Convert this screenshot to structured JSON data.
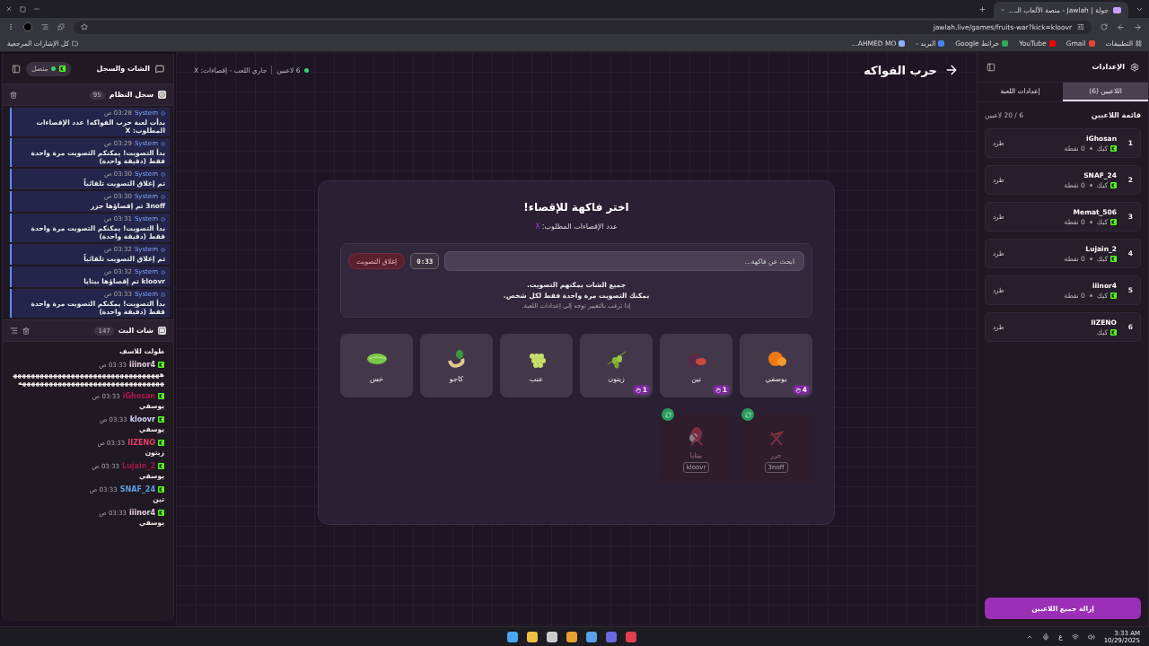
{
  "browser": {
    "tab_title": "جولة | Jawlah - منصة الألعاب الـ...",
    "url": "jawlah.live/games/fruits-war?kick=kloovr",
    "bookmarks": [
      {
        "label": "التطبيقات"
      },
      {
        "label": "Gmail"
      },
      {
        "label": "YouTube"
      },
      {
        "label": "خرائط Google"
      },
      {
        "label": "البريد -"
      },
      {
        "label": "AHMED MO..."
      }
    ],
    "all_bookmarks": "كل الإشارات المرجعية"
  },
  "settings_panel": {
    "title": "الإعدادات",
    "tabs": [
      {
        "label": "اللاعبين (6)",
        "selected": true
      },
      {
        "label": "إعدادات اللعبة",
        "selected": false
      }
    ],
    "list_title": "قائمة اللاعبين",
    "count": "6 / 20 لاعبين",
    "players": [
      {
        "rank": "1",
        "name": "iGhosan",
        "platform": "كيك",
        "points": "0 نقطة",
        "kick": "طرد"
      },
      {
        "rank": "2",
        "name": "SNAF_24",
        "platform": "كيك",
        "points": "0 نقطة",
        "kick": "طرد"
      },
      {
        "rank": "3",
        "name": "Memat_506",
        "platform": "كيك",
        "points": "0 نقطة",
        "kick": "طرد"
      },
      {
        "rank": "4",
        "name": "Lujain_2",
        "platform": "كيك",
        "points": "0 نقطة",
        "kick": "طرد"
      },
      {
        "rank": "5",
        "name": "iiinor4",
        "platform": "كيك",
        "points": "0 نقطة",
        "kick": "طرد"
      },
      {
        "rank": "6",
        "name": "IIZENO",
        "platform": "كيك",
        "kick": "طرد"
      }
    ],
    "remove_all": "إزالة جميع اللاعبين"
  },
  "game": {
    "title": "حرب الفواكه",
    "status": "جاري اللعب - إقصاءات: X",
    "players_online": "6 لاعبين",
    "heading": "اختر فاكهة للإقصاء!",
    "eliminations_label": "عدد الإقصاءات المطلوب:",
    "eliminations_value": "X",
    "search_placeholder": "ابحث عن فاكهة...",
    "timer": "0:33",
    "close_vote": "إغلاق التصويت",
    "notes": [
      {
        "text": "جميع الشات يمكنهم التصويت.",
        "kind": "strong"
      },
      {
        "text": "يمكنك التصويت مرة واحدة فقط لكل شخص.",
        "kind": "strong"
      },
      {
        "text": "إذا ترغب بالتغيير توجه إلى إعدادات اللعبة.",
        "kind": "hint"
      }
    ],
    "fruits": [
      {
        "name": "يوسفي",
        "votes": "4"
      },
      {
        "name": "تين",
        "votes": "1"
      },
      {
        "name": "زيتون",
        "votes": "1"
      },
      {
        "name": "عنب"
      },
      {
        "name": "كاجو"
      },
      {
        "name": "خس"
      }
    ],
    "eliminated": [
      {
        "name": "جزر",
        "by": "3noff"
      },
      {
        "name": "بيتايا",
        "by": "kloovr"
      }
    ]
  },
  "chat_panel": {
    "title": "الشات والسجل",
    "status": "متصل",
    "log": {
      "title": "سجل النظام",
      "count": "95",
      "entries": [
        {
          "sender": "System",
          "time": "03:28 ص",
          "text": "بدأت لعبة حرب الفواكه! عدد الإقصاءات المطلوب: X"
        },
        {
          "sender": "System",
          "time": "03:29 ص",
          "text": "بدأ التصويت! يمكنكم التصويت مرة واحدة فقط (دقيقة واحدة)"
        },
        {
          "sender": "System",
          "time": "03:30 ص",
          "text": "تم إغلاق التصويت تلقائياً"
        },
        {
          "sender": "System",
          "time": "03:30 ص",
          "text": "3noff تم إقصاؤها جزر"
        },
        {
          "sender": "System",
          "time": "03:31 ص",
          "text": "بدأ التصويت! يمكنكم التصويت مرة واحدة فقط (دقيقة واحدة)"
        },
        {
          "sender": "System",
          "time": "03:32 ص",
          "text": "تم إغلاق التصويت تلقائياً"
        },
        {
          "sender": "System",
          "time": "03:32 ص",
          "text": "kloovr تم إقصاؤها بيتايا"
        },
        {
          "sender": "System",
          "time": "03:33 ص",
          "text": "بدأ التصويت! يمكنكم التصويت مرة واحدة فقط (دقيقة واحدة)"
        }
      ]
    },
    "chat": {
      "title": "شات البث",
      "count": "147",
      "messages": [
        {
          "text": "طولت للاسف"
        },
        {
          "user": "iiinor4",
          "color": "#e6cfe0",
          "time": "03:33 ص",
          "text": "ههههههههههههههههههههههههههههههههههههههههههههههههههههههههههههههههههه"
        },
        {
          "user": "iGhosan",
          "color": "#b0184a",
          "time": "03:33 ص",
          "text": "يوسفي"
        },
        {
          "user": "kloovr",
          "color": "#d4d4ff",
          "time": "03:33 ص",
          "text": "يوسفي"
        },
        {
          "user": "IIZENO",
          "color": "#e0406a",
          "time": "03:33 ص",
          "text": "زيتون"
        },
        {
          "user": "Lujain_2",
          "color": "#a01848",
          "time": "03:33 ص",
          "text": "يوسفي"
        },
        {
          "user": "SNAF_24",
          "color": "#5aa0e8",
          "time": "03:33 ص",
          "text": "تين"
        },
        {
          "user": "iiinor4",
          "color": "#e6cfe0",
          "time": "03:33 ص",
          "text": "يوسفي"
        }
      ]
    }
  },
  "taskbar": {
    "time": "3:33 AM",
    "date": "10/29/2025",
    "language": "ع"
  }
}
